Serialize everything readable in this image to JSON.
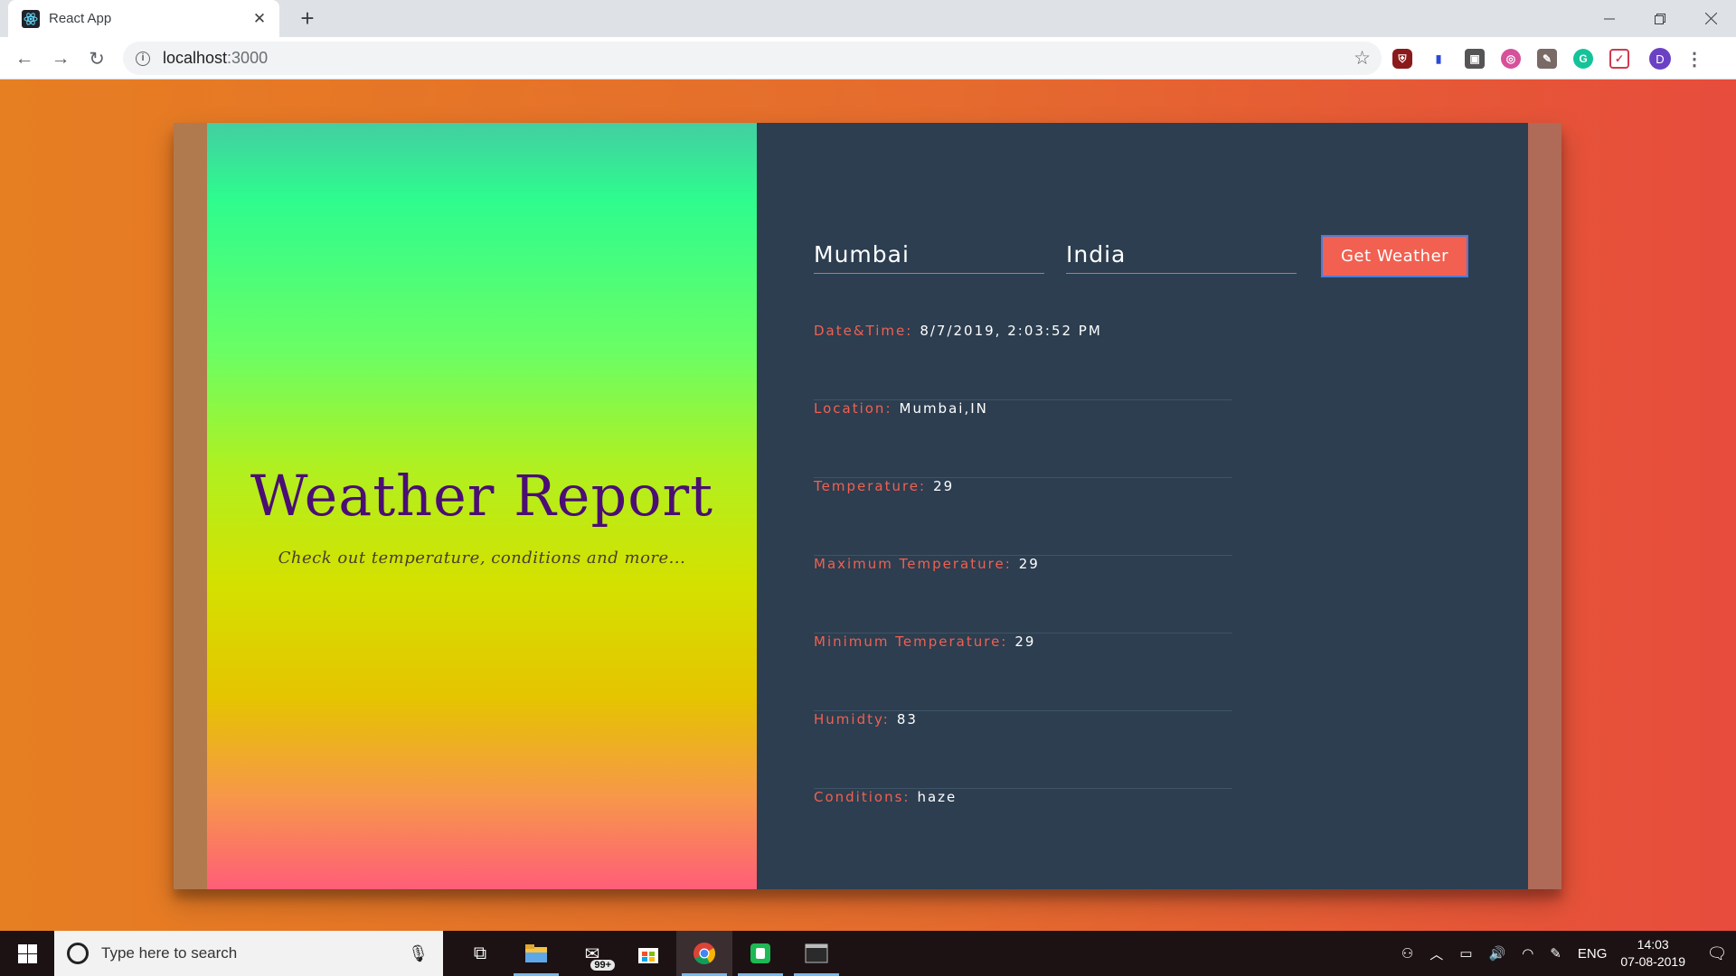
{
  "browser": {
    "tab_title": "React App",
    "url_host": "localhost",
    "url_port": ":3000",
    "profile_initial": "D"
  },
  "app": {
    "title": "Weather Report",
    "subtitle": "Check out temperature, conditions and more...",
    "form": {
      "city_value": "Mumbai",
      "country_value": "India",
      "button_label": "Get Weather"
    },
    "info": [
      {
        "label": "Date&Time:",
        "value": "8/7/2019, 2:03:52 PM"
      },
      {
        "label": "Location:",
        "value": "Mumbai,IN"
      },
      {
        "label": "Temperature:",
        "value": "29"
      },
      {
        "label": "Maximum Temperature:",
        "value": "29"
      },
      {
        "label": "Minimum Temperature:",
        "value": "29"
      },
      {
        "label": "Humidty:",
        "value": "83"
      },
      {
        "label": "Conditions:",
        "value": "haze"
      }
    ],
    "colors": {
      "accent": "#f16051",
      "panel": "#2c3e50",
      "title": "#4a0e74"
    }
  },
  "taskbar": {
    "search_placeholder": "Type here to search",
    "mail_badge": "99+",
    "language": "ENG",
    "time": "14:03",
    "date": "07-08-2019"
  }
}
